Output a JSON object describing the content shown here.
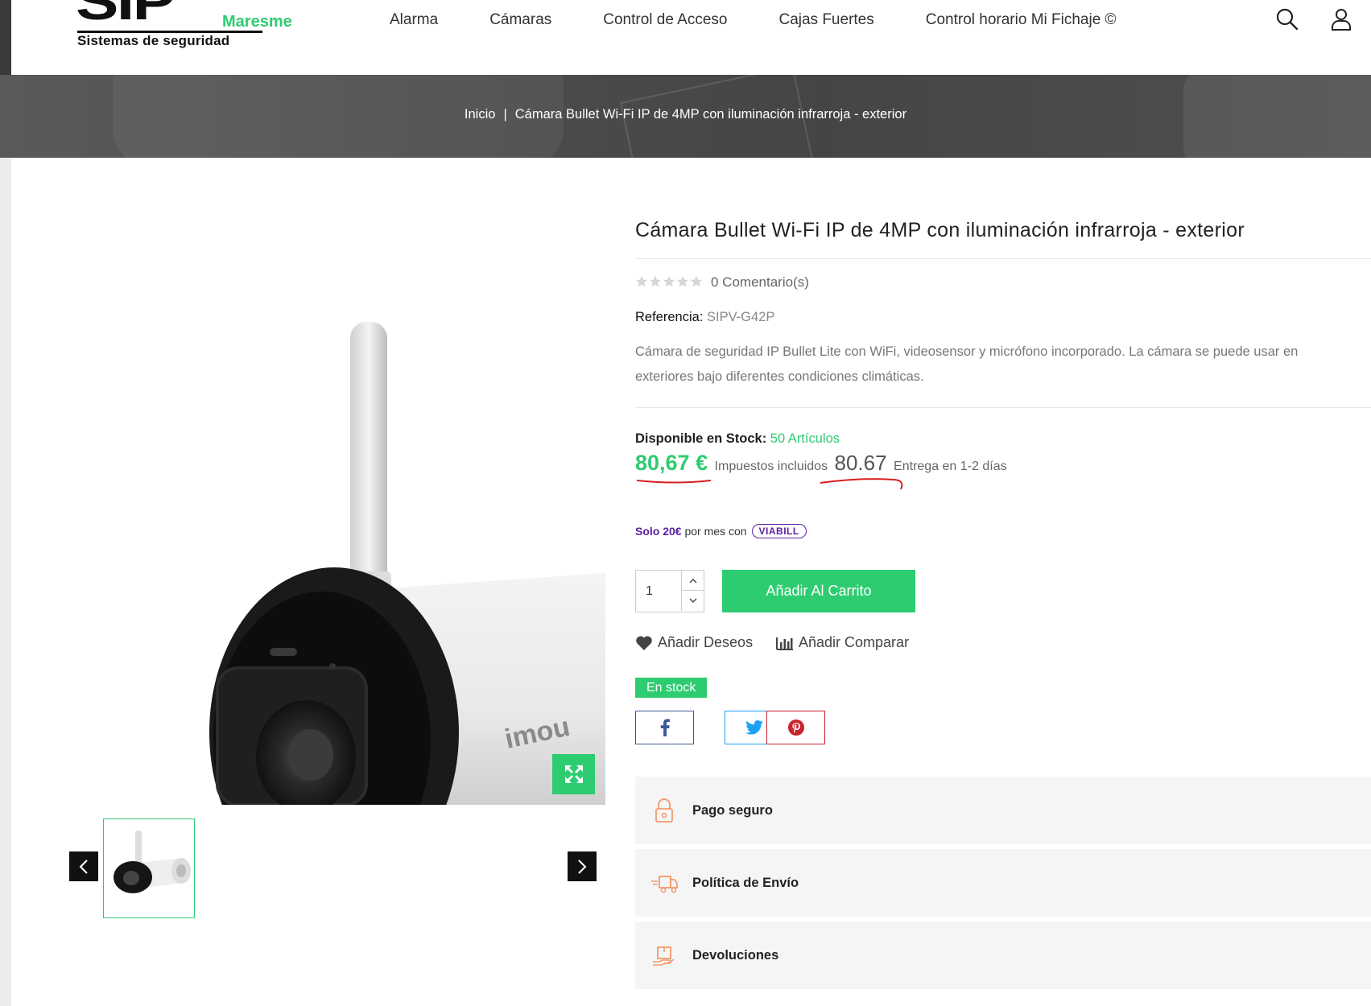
{
  "header": {
    "logo": {
      "brand": "SIP",
      "brand_suffix": "Maresme",
      "tagline": "Sistemas de seguridad"
    },
    "nav": [
      {
        "label": "Alarma"
      },
      {
        "label": "Cámaras"
      },
      {
        "label": "Control de Acceso"
      },
      {
        "label": "Cajas Fuertes"
      },
      {
        "label": "Control horario Mi Fichaje ©"
      }
    ],
    "icons": [
      "search-icon",
      "user-icon"
    ]
  },
  "breadcrumb": {
    "home": "Inicio",
    "separator": "|",
    "current": "Cámara Bullet Wi-Fi IP de 4MP con iluminación infrarroja - exterior"
  },
  "gallery": {
    "image_brand_text": "imou",
    "expand_icon": "expand-icon",
    "prev_icon": "chevron-left-icon",
    "next_icon": "chevron-right-icon"
  },
  "product": {
    "title": "Cámara Bullet Wi-Fi IP de 4MP con iluminación infrarroja - exterior",
    "rating": 0,
    "rating_max": 5,
    "comments_label": "0 Comentario(s)",
    "reference_label": "Referencia:",
    "reference_value": "SIPV-G42P",
    "description": "Cámara de seguridad IP Bullet Lite con WiFi, videosensor y micrófono incorporado. La cámara se puede usar en exteriores bajo diferentes condiciones climáticas.",
    "stock_label": "Disponible en Stock:",
    "stock_value": "50 Artículos",
    "price": "80,67 €",
    "tax_label": "Impuestos incluidos",
    "price_alt": "80.67",
    "delivery_label": "Entrega en 1-2 días",
    "viabill": {
      "solo": "Solo 20€",
      "text": "por mes con",
      "logo": "VIABILL"
    },
    "quantity": "1",
    "add_to_cart": "Añadir Al Carrito",
    "wishlist": "Añadir Deseos",
    "compare": "Añadir Comparar",
    "in_stock_badge": "En stock",
    "social": [
      "facebook-icon",
      "twitter-icon",
      "pinterest-icon"
    ]
  },
  "info_boxes": [
    {
      "label": "Pago seguro",
      "icon": "padlock-icon"
    },
    {
      "label": "Política de Envío",
      "icon": "delivery-truck-icon"
    },
    {
      "label": "Devoluciones",
      "icon": "return-box-icon"
    }
  ],
  "colors": {
    "accent": "#2ecc71",
    "annotation_red": "#d81f1f",
    "viabill_purple": "#5a1fa0"
  }
}
